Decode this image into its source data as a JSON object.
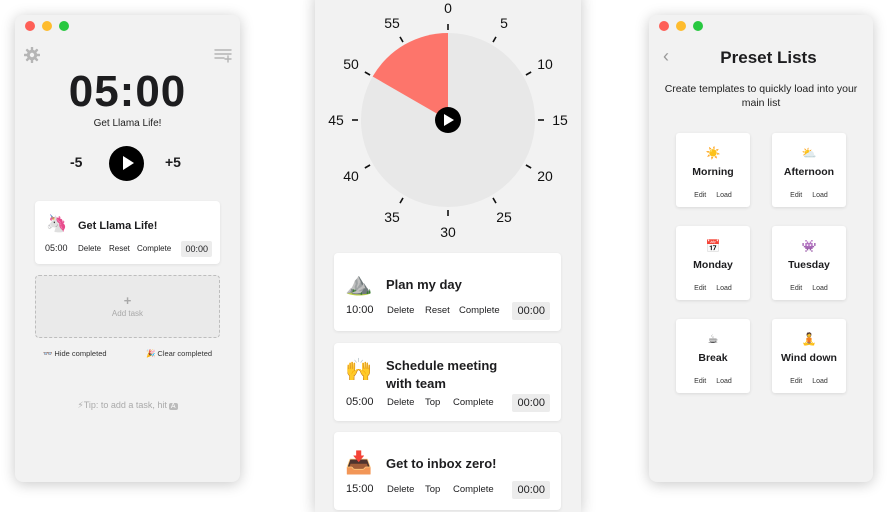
{
  "left_window": {
    "timer": "05:00",
    "subtitle": "Get Llama Life!",
    "minus": "-5",
    "plus": "+5",
    "task": {
      "emoji": "🦄",
      "name": "Get Llama Life!",
      "time": "05:00",
      "actions": [
        "Delete",
        "Reset",
        "Complete"
      ],
      "elapsed": "00:00"
    },
    "add_task_label": "Add task",
    "hide_completed": "👓 Hide completed",
    "clear_completed": "🎉 Clear completed",
    "tip": "⚡Tip: to add a task, hit",
    "tip_key": "A"
  },
  "middle_window": {
    "dial": {
      "labels": [
        "0",
        "5",
        "10",
        "15",
        "20",
        "25",
        "30",
        "35",
        "40",
        "45",
        "50",
        "55"
      ],
      "remaining_minutes": 10,
      "accent_color": "#fd756b"
    },
    "tasks": [
      {
        "emoji": "⛰️",
        "name_lines": [
          "Plan my day"
        ],
        "time": "10:00",
        "actions": [
          "Delete",
          "Reset",
          "Complete"
        ],
        "elapsed": "00:00"
      },
      {
        "emoji": "🙌",
        "name_lines": [
          "Schedule meeting",
          "with team"
        ],
        "time": "05:00",
        "actions": [
          "Delete",
          "Top",
          "Complete"
        ],
        "elapsed": "00:00"
      },
      {
        "emoji": "📥",
        "name_lines": [
          "Get to inbox zero!"
        ],
        "time": "15:00",
        "actions": [
          "Delete",
          "Top",
          "Complete"
        ],
        "elapsed": "00:00"
      }
    ]
  },
  "right_window": {
    "title": "Preset Lists",
    "description": "Create templates to quickly load into your main list",
    "presets": [
      {
        "emoji": "☀️",
        "name": "Morning",
        "edit": "Edit",
        "load": "Load"
      },
      {
        "emoji": "⛅",
        "name": "Afternoon",
        "edit": "Edit",
        "load": "Load"
      },
      {
        "emoji": "📅",
        "name": "Monday",
        "edit": "Edit",
        "load": "Load"
      },
      {
        "emoji": "👾",
        "name": "Tuesday",
        "edit": "Edit",
        "load": "Load"
      },
      {
        "emoji": "☕",
        "name": "Break",
        "edit": "Edit",
        "load": "Load"
      },
      {
        "emoji": "🧘",
        "name": "Wind down",
        "edit": "Edit",
        "load": "Load"
      }
    ]
  }
}
